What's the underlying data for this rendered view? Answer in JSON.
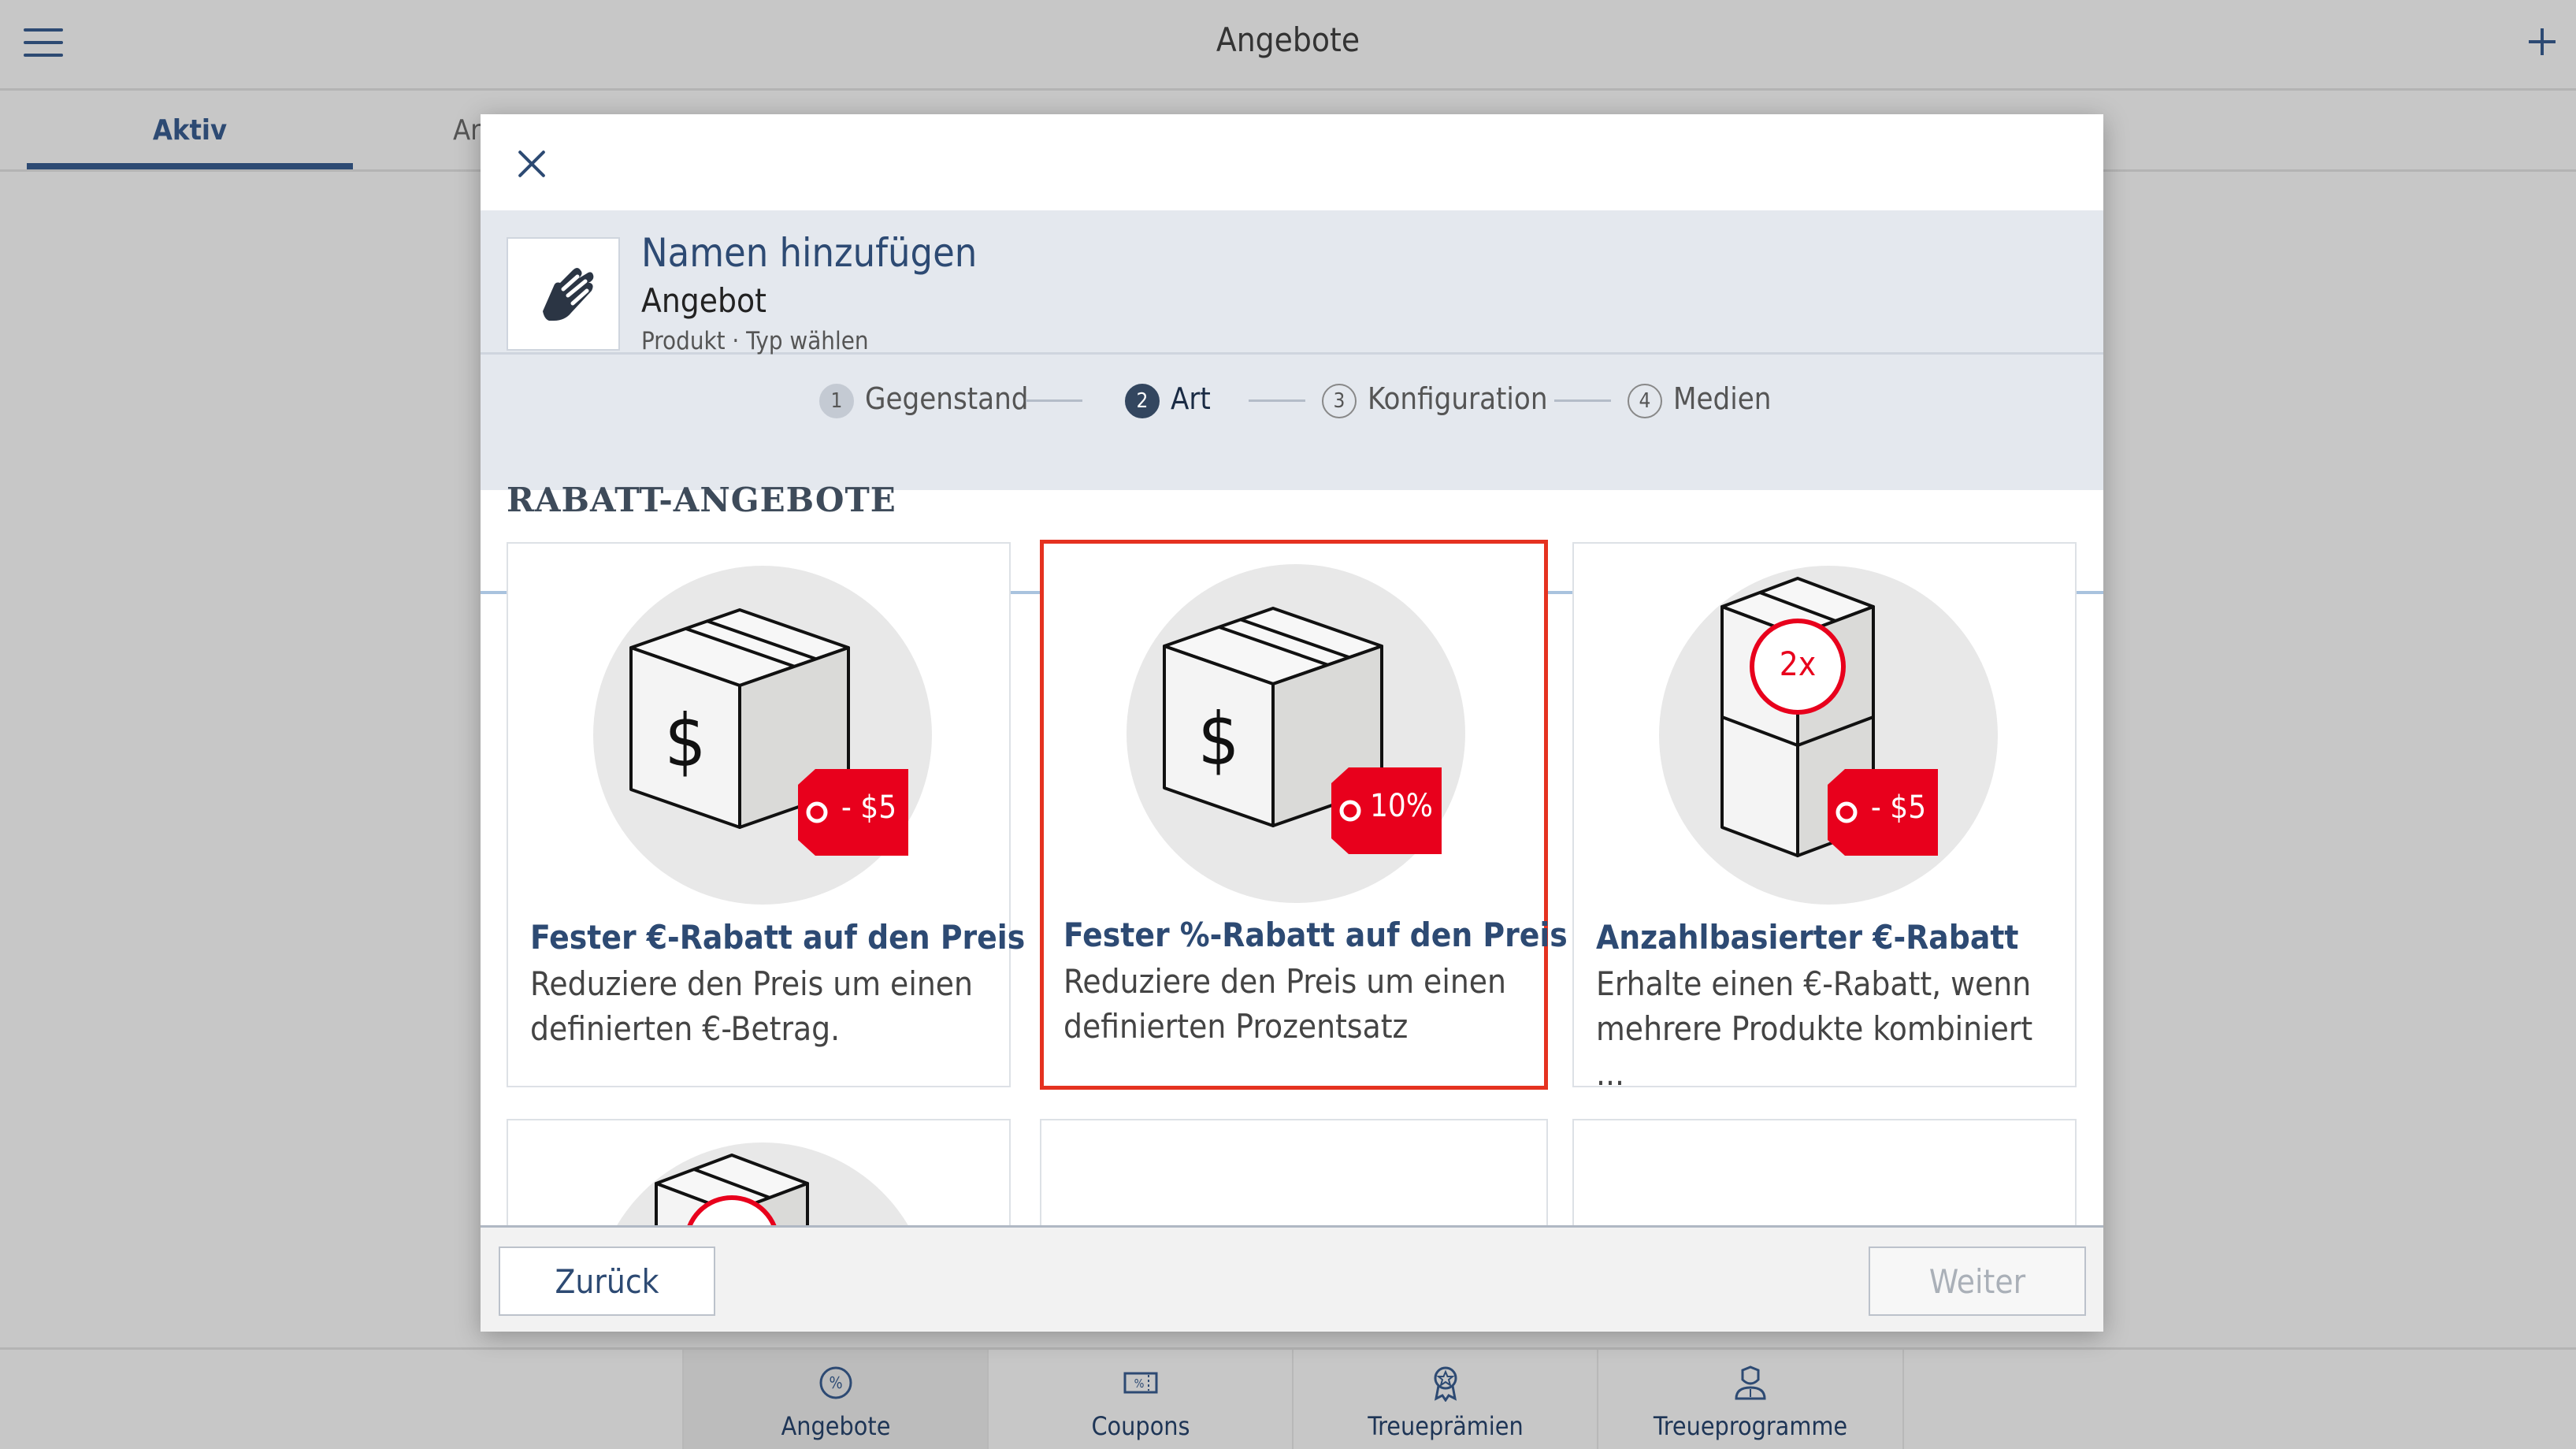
{
  "app": {
    "title": "Angebote"
  },
  "tabs": [
    {
      "label": "Aktiv"
    },
    {
      "label": "Ar"
    }
  ],
  "modal": {
    "title": "Namen hinzufügen",
    "subtitle": "Angebot",
    "breadcrumb": "Produkt · Typ wählen",
    "steps": [
      {
        "num": "1",
        "label": "Gegenstand",
        "state": "done"
      },
      {
        "num": "2",
        "label": "Art",
        "state": "current"
      },
      {
        "num": "3",
        "label": "Konfiguration",
        "state": "todo"
      },
      {
        "num": "4",
        "label": "Medien",
        "state": "todo"
      }
    ],
    "section_title": "RABATT-ANGEBOTE",
    "cards": [
      {
        "tag": "- $5",
        "title": "Fester €-Rabatt auf den Preis",
        "desc": "Reduziere den Preis um einen definierten €-Betrag.",
        "selected": false
      },
      {
        "tag": "10%",
        "title": "Fester %-Rabatt auf den Preis",
        "desc": "Reduziere den Preis um einen definierten Prozentsatz",
        "selected": true
      },
      {
        "tag": "- $5",
        "badge": "2x",
        "title": "Anzahlbasierter €-Rabatt",
        "desc": "Erhalte einen €-Rabatt, wenn mehrere Produkte kombiniert ...",
        "selected": false
      }
    ],
    "footer": {
      "back_label": "Zurück",
      "next_label": "Weiter"
    }
  },
  "bottom_nav": [
    {
      "label": "Angebote",
      "icon": "percent-badge-icon",
      "active": true
    },
    {
      "label": "Coupons",
      "icon": "coupon-icon",
      "active": false
    },
    {
      "label": "Treueprämien",
      "icon": "award-ribbon-icon",
      "active": false
    },
    {
      "label": "Treueprogramme",
      "icon": "member-icon",
      "active": false
    }
  ],
  "colors": {
    "brand": "#2d4a73",
    "accent_red": "#e8001c",
    "selected_border": "#e53220"
  }
}
